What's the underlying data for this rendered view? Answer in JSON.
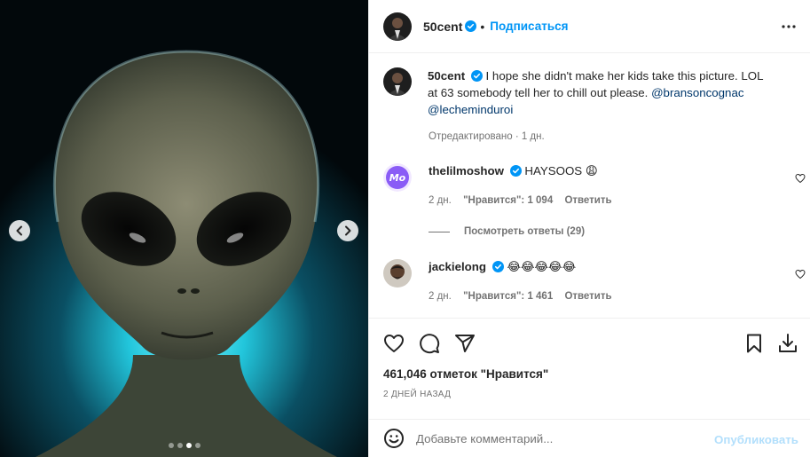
{
  "post": {
    "username": "50cent",
    "follow_label": "Подписаться",
    "separator": "•",
    "caption_text": "I hope she didn't make her kids take this picture. LOL at 63 somebody tell her to chill out please.",
    "mention_1": "@bransoncognac",
    "mention_2": "@lecheminduroi",
    "edited_label": "Отредактировано · 1 дн.",
    "carousel": {
      "slide_count": 4,
      "active_slide": 3
    }
  },
  "comments": [
    {
      "username": "thelilmoshow",
      "text": "HAYSOOS 😩",
      "avatar_text": "Mo",
      "age": "2 дн.",
      "likes": "\"Нравится\": 1 094",
      "reply_label": "Ответить",
      "view_replies": "Посмотреть ответы (29)"
    },
    {
      "username": "jackielong",
      "text": "😂😂😂😂😂",
      "age": "2 дн.",
      "likes": "\"Нравится\": 1 461",
      "reply_label": "Ответить"
    }
  ],
  "footer": {
    "likes_count": "461,046 отметок \"Нравится\"",
    "date": "2 ДНЕЙ НАЗАД",
    "comment_placeholder": "Добавьте комментарий...",
    "publish_label": "Опубликовать"
  },
  "colors": {
    "accent": "#0095f6",
    "verified": "#0095f6",
    "mention": "#00376b",
    "muted": "#737373",
    "publish_disabled": "#b2dffc"
  },
  "icons": [
    "heart-icon",
    "comment-icon",
    "share-icon",
    "bookmark-icon",
    "download-icon",
    "emoji-icon",
    "more-options-icon",
    "verified-icon",
    "chevron-left-icon",
    "chevron-right-icon"
  ]
}
